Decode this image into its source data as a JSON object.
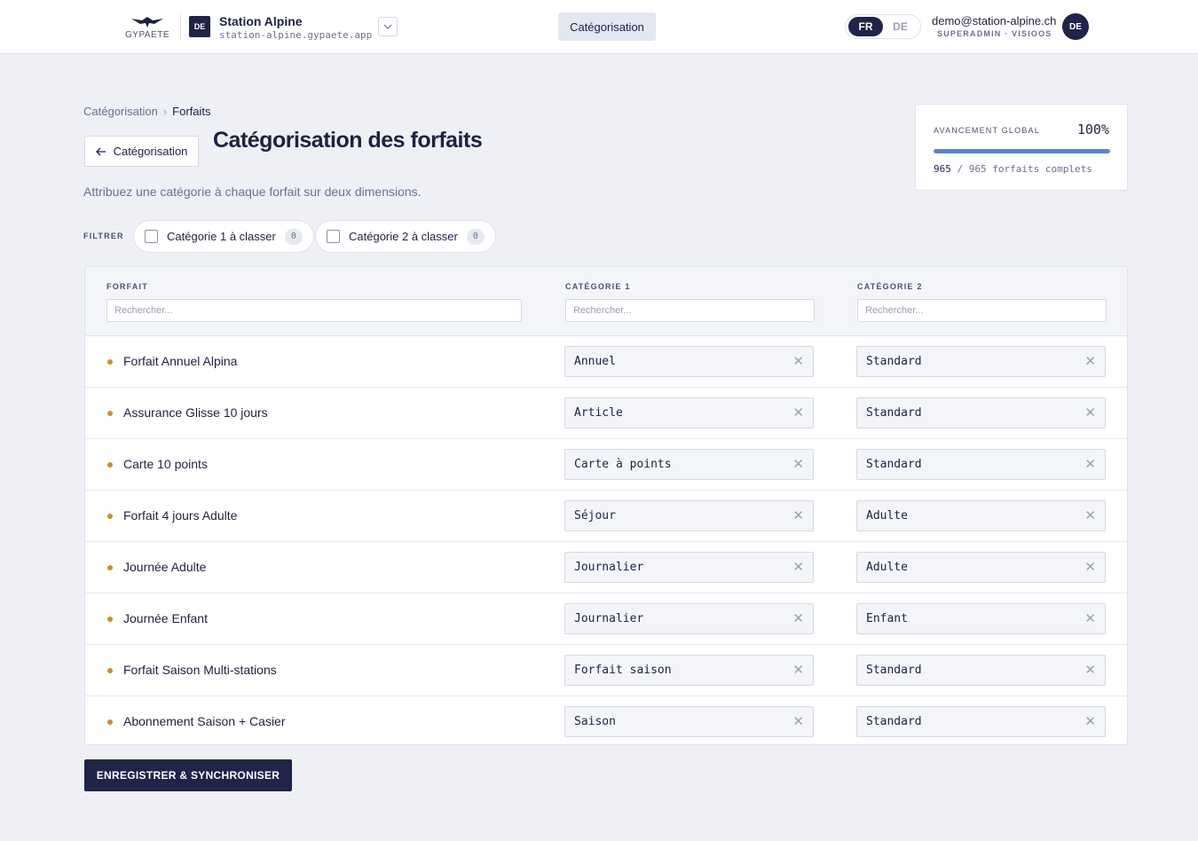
{
  "header": {
    "logo_text": "GYPAETE",
    "org_badge": "DE",
    "org_name": "Station Alpine",
    "org_url": "station-alpine.gypaete.app",
    "nav_tab": "Catégorisation",
    "languages": [
      "FR",
      "DE"
    ],
    "active_language": "FR",
    "user_email": "demo@station-alpine.ch",
    "user_role": "SUPERADMIN · VISIOOS",
    "avatar_initials": "DE"
  },
  "breadcrumb": {
    "parent": "Catégorisation",
    "separator": "›",
    "current": "Forfaits"
  },
  "back_button": {
    "label": "Catégorisation"
  },
  "page": {
    "title": "Catégorisation des forfaits",
    "subtitle": "Attribuez une catégorie à chaque forfait sur deux dimensions."
  },
  "progress": {
    "label": "AVANCEMENT GLOBAL",
    "percent_text": "100%",
    "fraction": 1.0,
    "done": "965",
    "total_text": "/ 965 forfaits complets"
  },
  "filters": {
    "label": "FILTRER",
    "chips": [
      {
        "label": "Catégorie 1 à classer",
        "count": "0"
      },
      {
        "label": "Catégorie 2 à classer",
        "count": "0"
      }
    ]
  },
  "table": {
    "columns": [
      {
        "label": "FORFAIT",
        "placeholder": "Rechercher..."
      },
      {
        "label": "CATÉGORIE 1",
        "placeholder": "Rechercher..."
      },
      {
        "label": "CATÉGORIE 2",
        "placeholder": "Rechercher..."
      }
    ],
    "rows": [
      {
        "name": "Forfait Annuel Alpina",
        "cat1": "Annuel",
        "cat2": "Standard"
      },
      {
        "name": "Assurance Glisse 10 jours",
        "cat1": "Article",
        "cat2": "Standard"
      },
      {
        "name": "Carte 10 points",
        "cat1": "Carte à points",
        "cat2": "Standard"
      },
      {
        "name": "Forfait 4 jours Adulte",
        "cat1": "Séjour",
        "cat2": "Adulte"
      },
      {
        "name": "Journée Adulte",
        "cat1": "Journalier",
        "cat2": "Adulte"
      },
      {
        "name": "Journée Enfant",
        "cat1": "Journalier",
        "cat2": "Enfant"
      },
      {
        "name": "Forfait Saison Multi-stations",
        "cat1": "Forfait saison",
        "cat2": "Standard"
      },
      {
        "name": "Abonnement Saison + Casier",
        "cat1": "Saison",
        "cat2": "Standard"
      }
    ],
    "clear_glyph": "✕"
  },
  "save_button": {
    "label": "ENREGISTRER & SYNCHRONISER"
  },
  "colors": {
    "primary": "#1f2448",
    "accent_bar": "#5b84cf",
    "status_dot": "#c7902e"
  }
}
